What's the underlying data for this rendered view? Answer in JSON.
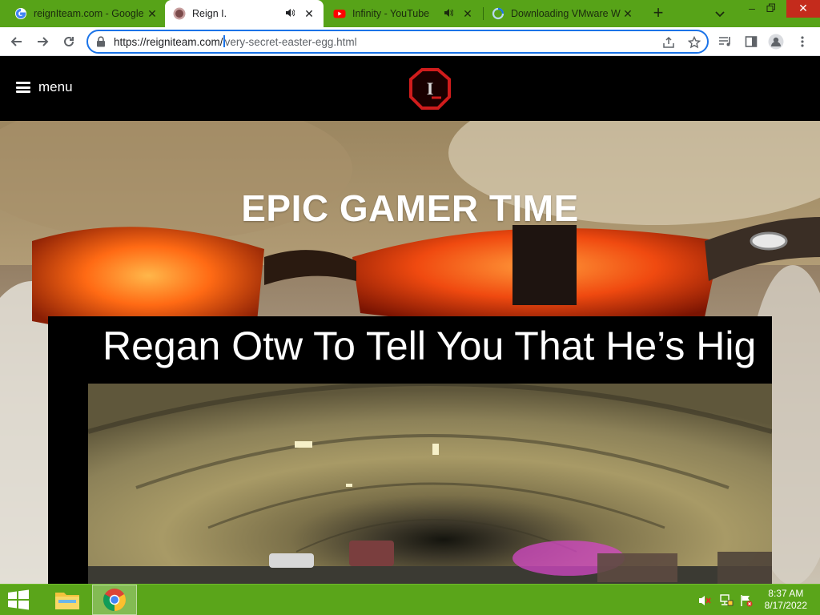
{
  "browser": {
    "tabs": [
      {
        "title": "reignIteam.com - Google",
        "icon": "google-favicon",
        "active": false
      },
      {
        "title": "Reign I.",
        "icon": "reign-favicon",
        "active": true,
        "audio": true
      },
      {
        "title": "Infinity - YouTube",
        "icon": "youtube-favicon",
        "active": false,
        "audio": true
      },
      {
        "title": "Downloading VMware W",
        "icon": "vmware-favicon",
        "active": false
      }
    ],
    "new_tab_symbol": "+",
    "url_host": "https://reigniteam.com/",
    "url_path": "very-secret-easter-egg.html"
  },
  "site": {
    "menu_label": "menu",
    "logo_text": "I",
    "hero_title": "EPIC GAMER TIME",
    "video_title": "Regan Otw To Tell You That He’s Hig"
  },
  "taskbar": {
    "time": "8:37 AM",
    "date": "8/17/2022"
  },
  "colors": {
    "accent_green": "#57a318",
    "omnibox_focus": "#1a73e8",
    "logo_red": "#d01c1c"
  }
}
